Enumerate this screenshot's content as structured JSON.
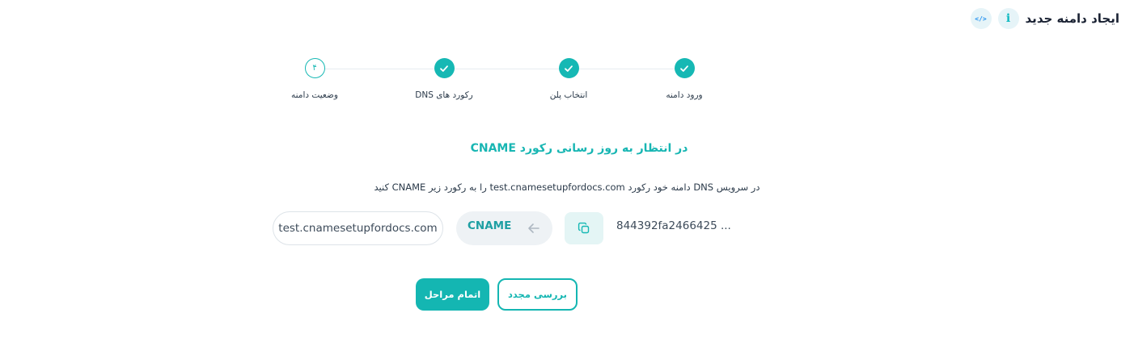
{
  "header": {
    "title": "ایجاد دامنه جدید",
    "info_icon_glyph": "i",
    "code_icon_glyph": "</>"
  },
  "stepper": {
    "steps": [
      {
        "label": "ورود دامنه",
        "status": "done"
      },
      {
        "label": "انتخاب پلن",
        "status": "done"
      },
      {
        "label": "رکورد های DNS",
        "status": "done"
      },
      {
        "label": "وضعیت دامنه",
        "status": "current",
        "number": "۴"
      }
    ]
  },
  "main": {
    "heading": "در انتظار به روز رسانی رکورد CNAME",
    "instruction": "در سرویس DNS دامنه خود رکورد test.cnamesetupfordocs.com را به رکورد زیر CNAME کنید",
    "record": {
      "target": "test.cnamesetupfordocs.com",
      "type": "CNAME",
      "source": "844392fa2466425 ..."
    }
  },
  "actions": {
    "finish_label": "اتمام مراحل",
    "recheck_label": "بررسی مجدد"
  },
  "colors": {
    "accent": "#16b8b4",
    "header_icon_bg": "#e6f4f8"
  }
}
